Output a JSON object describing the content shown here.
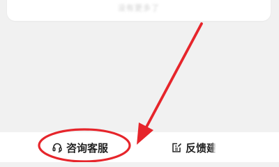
{
  "colors": {
    "page_background": "#f1f1f1",
    "bar_background": "#ffffff",
    "text": "#222222",
    "annotation_red": "#e6252b"
  },
  "top_card": {
    "hint_text": "没有更多了"
  },
  "bottom_bar": {
    "consult_label": "咨询客服",
    "consult_icon": "headset-icon",
    "feedback_label": "反馈建",
    "feedback_icon": "edit-note-icon"
  }
}
